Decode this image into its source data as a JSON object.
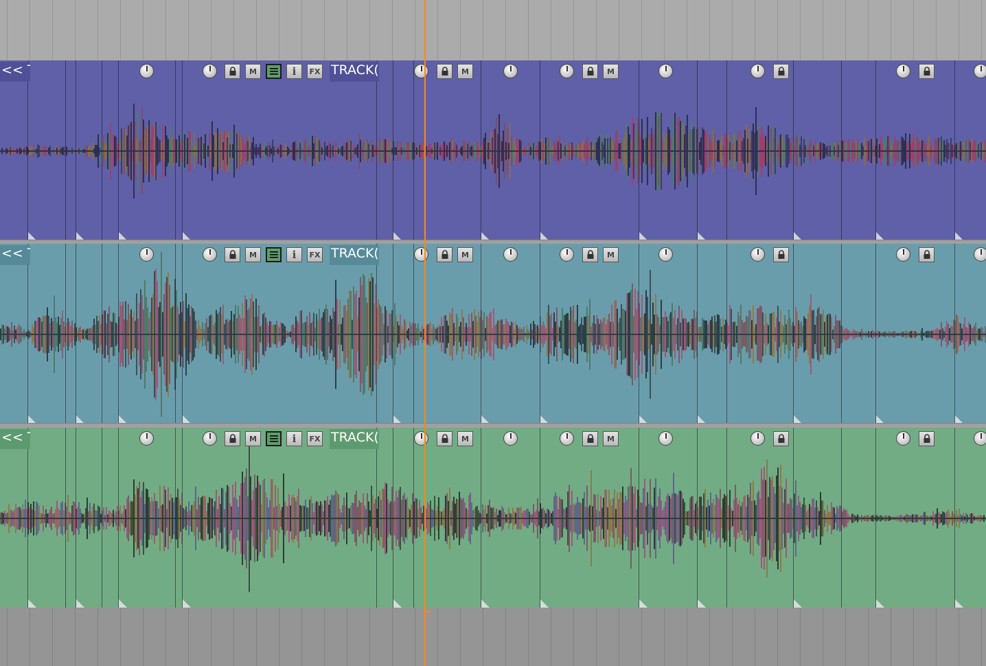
{
  "tracks": [
    {
      "id": "track-1",
      "color": "#6060a8",
      "label_bg": "#505096",
      "wave_colors": [
        "#2e2e52",
        "#3c3c66",
        "#7a4e6e",
        "#8a6a4e",
        "#4f7a6a",
        "#a03e6e"
      ],
      "start_label": "<< T",
      "item_label": "TRACK("
    },
    {
      "id": "track-2",
      "color": "#6a9dab",
      "label_bg": "#568a98",
      "wave_colors": [
        "#2c3e46",
        "#3a5058",
        "#7a5a66",
        "#8a7a4e",
        "#4f7a6a",
        "#9a5a7a"
      ],
      "start_label": "<< T",
      "item_label": "TRACK("
    },
    {
      "id": "track-3",
      "color": "#72ac84",
      "label_bg": "#5e9a70",
      "wave_colors": [
        "#2c3e34",
        "#3a5240",
        "#7a5a66",
        "#8a7a4e",
        "#5a6a8a",
        "#9a5a7a"
      ],
      "start_label": "<< T",
      "item_label": "TRACK("
    }
  ],
  "icons": {
    "volume_knob": "knob-icon",
    "lock": "lock-icon",
    "mute": "mute-icon",
    "properties": "menu-lines-icon",
    "info": "info-icon",
    "fx": "fx-icon"
  },
  "button_text": {
    "mute": "M",
    "info": "i",
    "fx": "FX"
  },
  "colors": {
    "playhead": "#f08a28",
    "ruler": "#ababab",
    "background": "#959595",
    "active_button": "#5e9e6a"
  }
}
